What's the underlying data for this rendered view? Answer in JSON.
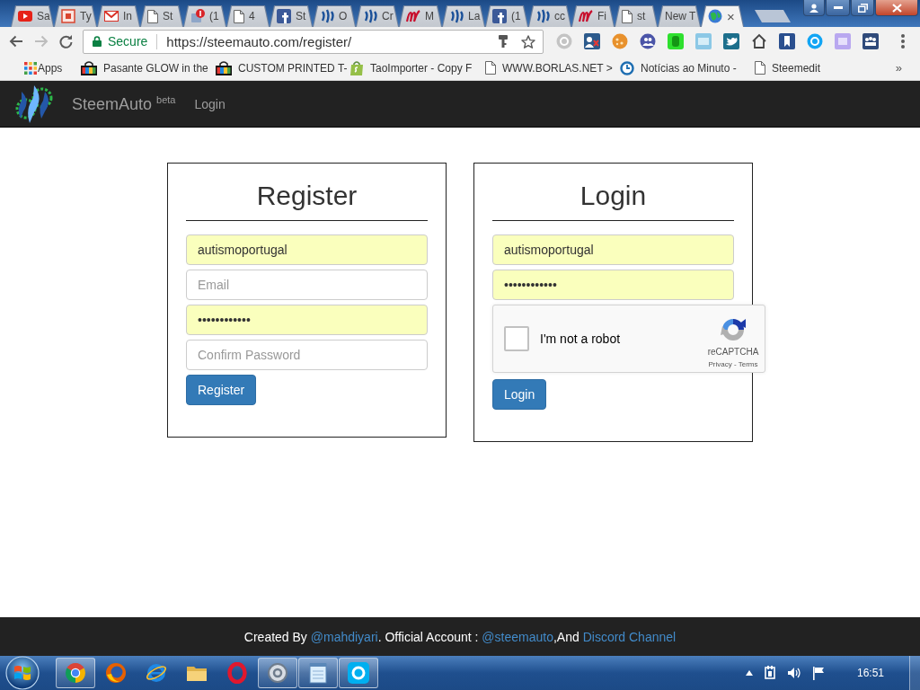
{
  "browser": {
    "tabs": [
      {
        "kind": "video",
        "title": "Sa",
        "selected": false
      },
      {
        "kind": "box",
        "title": "Ty",
        "selected": false
      },
      {
        "kind": "mail",
        "title": "In",
        "selected": false
      },
      {
        "kind": "page",
        "title": "St",
        "selected": false
      },
      {
        "kind": "badge",
        "title": "(1",
        "selected": false
      },
      {
        "kind": "page",
        "title": "4",
        "selected": false
      },
      {
        "kind": "tile",
        "title": "St",
        "selected": false
      },
      {
        "kind": "swirl",
        "title": "O",
        "selected": false
      },
      {
        "kind": "swirl",
        "title": "Cr",
        "selected": false
      },
      {
        "kind": "scribble",
        "title": "M",
        "selected": false
      },
      {
        "kind": "swirl",
        "title": "La",
        "selected": false
      },
      {
        "kind": "tile",
        "title": "(1",
        "selected": false
      },
      {
        "kind": "swirl",
        "title": "cc",
        "selected": false
      },
      {
        "kind": "scribble",
        "title": "Fi",
        "selected": false
      },
      {
        "kind": "page",
        "title": "st",
        "selected": false
      },
      {
        "kind": "none",
        "title": "New T",
        "selected": false
      },
      {
        "kind": "globe",
        "close": "×",
        "selected": true
      }
    ],
    "navigation": {
      "back_disabled": false,
      "forward_disabled": true
    },
    "address": {
      "security": "Secure",
      "url": "https://steemauto.com/register/"
    },
    "bookmarks": [
      {
        "kind": "apps",
        "title": "Apps"
      },
      {
        "kind": "bag",
        "title": "Pasante GLOW in the"
      },
      {
        "kind": "bag",
        "title": "CUSTOM PRINTED T-"
      },
      {
        "kind": "shop",
        "title": "TaoImporter - Copy F"
      },
      {
        "kind": "page",
        "title": "WWW.BORLAS.NET >"
      },
      {
        "kind": "clock",
        "title": "Notícias ao Minuto -"
      },
      {
        "kind": "page",
        "title": "Steemedit"
      }
    ],
    "more_bookmarks": "»"
  },
  "page": {
    "brand": "SteemAuto $^{beta}$",
    "nav": [
      {
        "label": "Login"
      }
    ],
    "register": {
      "title": "Register",
      "fields": [
        {
          "value": "autismoportugal",
          "autofilled": true
        },
        {
          "placeholder": "Email",
          "autofilled": false
        },
        {
          "value": "••••••••••••",
          "autofilled": true
        },
        {
          "placeholder": "Confirm Password",
          "autofilled": false
        }
      ],
      "button": "Register"
    },
    "login": {
      "title": "Login",
      "fields": [
        {
          "value": "autismoportugal",
          "autofilled": true
        },
        {
          "value": "••••••••••••",
          "autofilled": true
        }
      ],
      "captcha": {
        "label": "I'm not a robot",
        "checked": false,
        "brand": "reCAPTCHA",
        "links": "Privacy - Terms"
      },
      "button": "Login"
    },
    "footer": [
      {
        "kind": "text",
        "text": "Created By "
      },
      {
        "kind": "link",
        "text": "@mahdiyari"
      },
      {
        "kind": "text",
        "text": ". Official Account : "
      },
      {
        "kind": "link",
        "text": "@steemauto"
      },
      {
        "kind": "text",
        "text": ",And "
      },
      {
        "kind": "link",
        "text": "Discord Channel"
      }
    ]
  },
  "taskbar": {
    "apps": [
      {
        "kind": "segmented",
        "running": true
      },
      {
        "kind": "globe",
        "running": false
      },
      {
        "kind": "orbit",
        "running": false
      },
      {
        "kind": "folder",
        "running": false
      },
      {
        "kind": "ring",
        "running": false
      },
      {
        "kind": "disc",
        "running": true
      },
      {
        "kind": "notepad",
        "running": true
      },
      {
        "kind": "tile",
        "running": true
      }
    ],
    "clock": "16:51"
  }
}
